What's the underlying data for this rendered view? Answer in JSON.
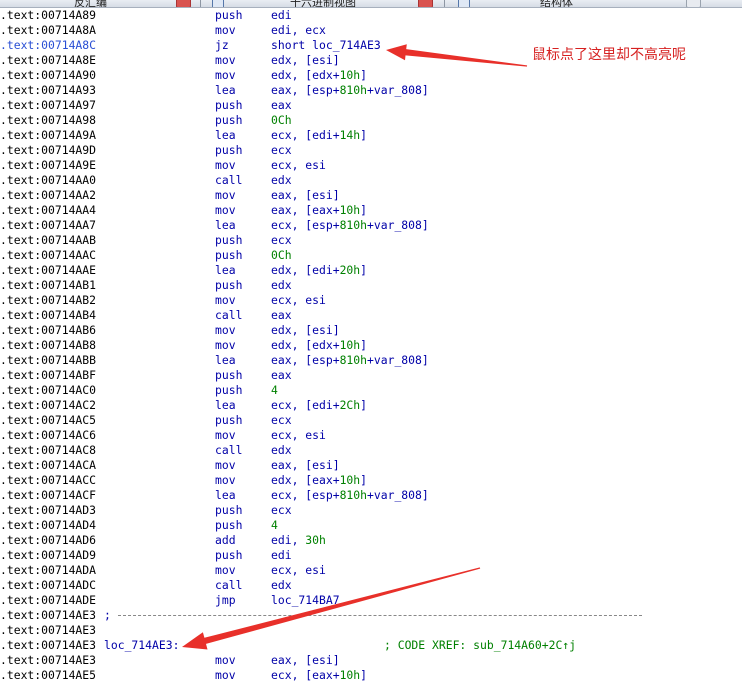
{
  "window": {
    "tabs": [
      {
        "label": "反汇编",
        "has_close": true
      },
      {
        "label": "十六进制视图",
        "has_close": true
      },
      {
        "label": "结构体",
        "has_close": false
      }
    ]
  },
  "listing": {
    "lines": [
      {
        "addr": ".text:00714A89",
        "mnemonic": "push",
        "operand": "edi"
      },
      {
        "addr": ".text:00714A8A",
        "mnemonic": "mov",
        "operand": "edi, ecx"
      },
      {
        "addr": ".text:00714A8C",
        "mnemonic": "jz",
        "operand": "short loc_714AE3",
        "selected": true
      },
      {
        "addr": ".text:00714A8E",
        "mnemonic": "mov",
        "operand": "edx, [esi]"
      },
      {
        "addr": ".text:00714A90",
        "mnemonic": "mov",
        "operand": "edx, [edx+",
        "num": "10h",
        "suffix": "]"
      },
      {
        "addr": ".text:00714A93",
        "mnemonic": "lea",
        "operand": "eax, [esp+",
        "num": "810h",
        "suffix": "+var_808]"
      },
      {
        "addr": ".text:00714A97",
        "mnemonic": "push",
        "operand": "eax"
      },
      {
        "addr": ".text:00714A98",
        "mnemonic": "push",
        "operand": "",
        "num": "0Ch"
      },
      {
        "addr": ".text:00714A9A",
        "mnemonic": "lea",
        "operand": "ecx, [edi+",
        "num": "14h",
        "suffix": "]"
      },
      {
        "addr": ".text:00714A9D",
        "mnemonic": "push",
        "operand": "ecx"
      },
      {
        "addr": ".text:00714A9E",
        "mnemonic": "mov",
        "operand": "ecx, esi"
      },
      {
        "addr": ".text:00714AA0",
        "mnemonic": "call",
        "operand": "edx"
      },
      {
        "addr": ".text:00714AA2",
        "mnemonic": "mov",
        "operand": "eax, [esi]"
      },
      {
        "addr": ".text:00714AA4",
        "mnemonic": "mov",
        "operand": "eax, [eax+",
        "num": "10h",
        "suffix": "]"
      },
      {
        "addr": ".text:00714AA7",
        "mnemonic": "lea",
        "operand": "ecx, [esp+",
        "num": "810h",
        "suffix": "+var_808]"
      },
      {
        "addr": ".text:00714AAB",
        "mnemonic": "push",
        "operand": "ecx"
      },
      {
        "addr": ".text:00714AAC",
        "mnemonic": "push",
        "operand": "",
        "num": "0Ch"
      },
      {
        "addr": ".text:00714AAE",
        "mnemonic": "lea",
        "operand": "edx, [edi+",
        "num": "20h",
        "suffix": "]"
      },
      {
        "addr": ".text:00714AB1",
        "mnemonic": "push",
        "operand": "edx"
      },
      {
        "addr": ".text:00714AB2",
        "mnemonic": "mov",
        "operand": "ecx, esi"
      },
      {
        "addr": ".text:00714AB4",
        "mnemonic": "call",
        "operand": "eax"
      },
      {
        "addr": ".text:00714AB6",
        "mnemonic": "mov",
        "operand": "edx, [esi]"
      },
      {
        "addr": ".text:00714AB8",
        "mnemonic": "mov",
        "operand": "edx, [edx+",
        "num": "10h",
        "suffix": "]"
      },
      {
        "addr": ".text:00714ABB",
        "mnemonic": "lea",
        "operand": "eax, [esp+",
        "num": "810h",
        "suffix": "+var_808]"
      },
      {
        "addr": ".text:00714ABF",
        "mnemonic": "push",
        "operand": "eax"
      },
      {
        "addr": ".text:00714AC0",
        "mnemonic": "push",
        "operand": "",
        "num": "4"
      },
      {
        "addr": ".text:00714AC2",
        "mnemonic": "lea",
        "operand": "ecx, [edi+",
        "num": "2Ch",
        "suffix": "]"
      },
      {
        "addr": ".text:00714AC5",
        "mnemonic": "push",
        "operand": "ecx"
      },
      {
        "addr": ".text:00714AC6",
        "mnemonic": "mov",
        "operand": "ecx, esi"
      },
      {
        "addr": ".text:00714AC8",
        "mnemonic": "call",
        "operand": "edx"
      },
      {
        "addr": ".text:00714ACA",
        "mnemonic": "mov",
        "operand": "eax, [esi]"
      },
      {
        "addr": ".text:00714ACC",
        "mnemonic": "mov",
        "operand": "edx, [eax+",
        "num": "10h",
        "suffix": "]"
      },
      {
        "addr": ".text:00714ACF",
        "mnemonic": "lea",
        "operand": "ecx, [esp+",
        "num": "810h",
        "suffix": "+var_808]"
      },
      {
        "addr": ".text:00714AD3",
        "mnemonic": "push",
        "operand": "ecx"
      },
      {
        "addr": ".text:00714AD4",
        "mnemonic": "push",
        "operand": "",
        "num": "4"
      },
      {
        "addr": ".text:00714AD6",
        "mnemonic": "add",
        "operand": "edi, ",
        "num": "30h"
      },
      {
        "addr": ".text:00714AD9",
        "mnemonic": "push",
        "operand": "edi"
      },
      {
        "addr": ".text:00714ADA",
        "mnemonic": "mov",
        "operand": "ecx, esi"
      },
      {
        "addr": ".text:00714ADC",
        "mnemonic": "call",
        "operand": "edx"
      },
      {
        "addr": ".text:00714ADE",
        "mnemonic": "jmp",
        "operand": "loc_714BA7"
      },
      {
        "addr": ".text:00714AE3",
        "separator": true,
        "sep_text": ";"
      },
      {
        "addr": ".text:00714AE3"
      },
      {
        "addr": ".text:00714AE3",
        "label": "loc_714AE3:",
        "comment": "; CODE XREF: sub_714A60+2C↑j"
      },
      {
        "addr": ".text:00714AE3",
        "mnemonic": "mov",
        "operand": "eax, [esi]"
      },
      {
        "addr": ".text:00714AE5",
        "mnemonic": "mov",
        "operand": "ecx, [eax+",
        "num": "10h",
        "suffix": "]"
      }
    ]
  },
  "annotation": {
    "note": "鼠标点了这里却不高亮呢",
    "color": "#e8302a"
  }
}
